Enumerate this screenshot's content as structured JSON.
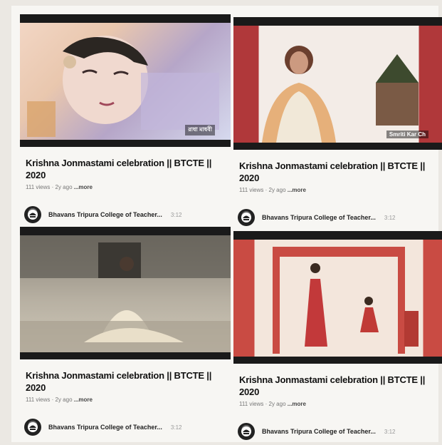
{
  "videos": [
    {
      "title": "Krishna Jonmastami celebration || BTCTE || 2020",
      "meta": "111 views · 2y ago",
      "more": "...more",
      "channel": "Bhavans Tripura College of Teacher...",
      "overlay": "রাধা মাধবী"
    },
    {
      "title": "Krishna Jonmastami celebration || BTCTE || 2020",
      "meta": "111 views · 2y ago",
      "more": "...more",
      "channel": "Bhavans Tripura College of Teacher...",
      "overlay": "Smriti Kar Ch"
    },
    {
      "title": "Krishna Jonmastami celebration || BTCTE || 2020",
      "meta": "111 views · 2y ago",
      "more": "...more",
      "channel": "Bhavans Tripura College of Teacher..."
    },
    {
      "title": "Krishna Jonmastami celebration || BTCTE || 2020",
      "meta": "111 views · 2y ago",
      "more": "...more",
      "channel": "Bhavans Tripura College of Teacher..."
    }
  ],
  "channel_extra": "3:12",
  "icons": {
    "avatar": "college-logo-icon"
  }
}
